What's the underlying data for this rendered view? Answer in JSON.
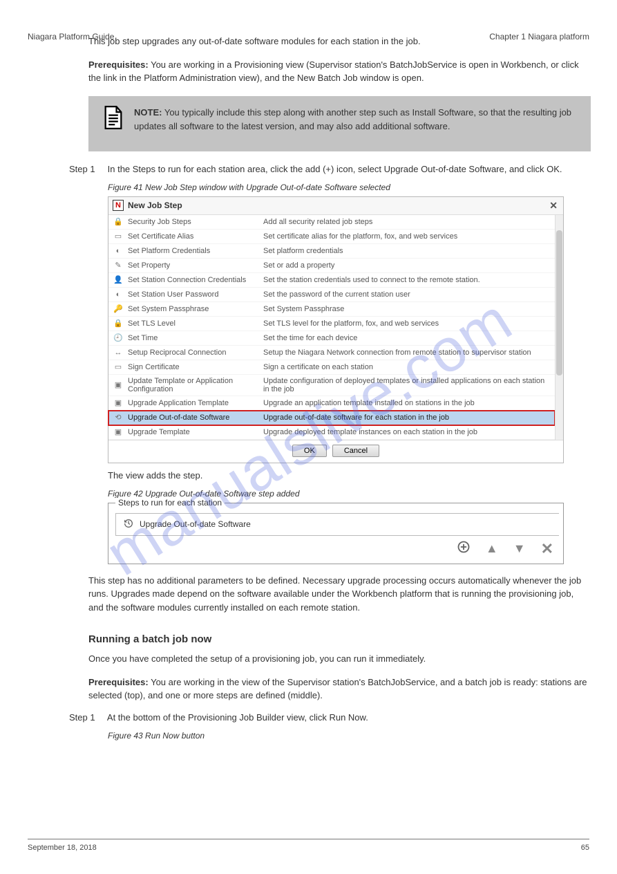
{
  "header": {
    "left": "Niagara Platform Guide",
    "right": "Chapter 1 Niagara platform"
  },
  "intro": "This job step upgrades any out-of-date software modules for each station in the job.",
  "prereq_label": "Prerequisites:",
  "prereq_text": "You are working in a Provisioning view (Supervisor station's BatchJobService is open in Workbench, or click the link in the Platform Administration view), and the New Batch Job window is open.",
  "note": {
    "label": "NOTE:",
    "text": "You typically include this step along with another step such as Install Software, so that the resulting job updates all software to the latest version, and may also add additional software."
  },
  "step1": "In the Steps to run for each station area, click the add (+) icon, select Upgrade Out-of-date Software, and click OK.",
  "step1_num": "Step 1",
  "figure1_caption": "Figure 41  New Job Step window with Upgrade Out-of-date Software selected",
  "dialog": {
    "title": "New Job Step",
    "rows": [
      {
        "icon": "🔒",
        "name": "Security Job Steps",
        "desc": "Add all security related job steps"
      },
      {
        "icon": "▭",
        "name": "Set Certificate Alias",
        "desc": "Set certificate alias for the platform, fox, and web services"
      },
      {
        "icon": "◐",
        "name": "Set Platform Credentials",
        "desc": "Set platform credentials"
      },
      {
        "icon": "✎",
        "name": "Set Property",
        "desc": "Set or add a property"
      },
      {
        "icon": "👤",
        "name": "Set Station Connection Credentials",
        "desc": "Set the station credentials used to connect to the remote station."
      },
      {
        "icon": "◐",
        "name": "Set Station User Password",
        "desc": "Set the password of the current station user"
      },
      {
        "icon": "🔑",
        "name": "Set System Passphrase",
        "desc": "Set System Passphrase"
      },
      {
        "icon": "🔒",
        "name": "Set TLS Level",
        "desc": "Set TLS level for the platform, fox, and web services"
      },
      {
        "icon": "🕘",
        "name": "Set Time",
        "desc": "Set the time for each device"
      },
      {
        "icon": "↔",
        "name": "Setup Reciprocal Connection",
        "desc": "Setup the Niagara Network connection from remote station to supervisor station"
      },
      {
        "icon": "▭",
        "name": "Sign Certificate",
        "desc": "Sign a certificate on each station"
      },
      {
        "icon": "▣",
        "name": "Update Template or Application Configuration",
        "desc": "Update configuration of deployed templates or installed applications on each station in the job"
      },
      {
        "icon": "▣",
        "name": "Upgrade Application Template",
        "desc": "Upgrade an application template installed on stations in the job"
      },
      {
        "icon": "⟲",
        "name": "Upgrade Out-of-date Software",
        "desc": "Upgrade out-of-date software for each station in the job",
        "selected": true
      },
      {
        "icon": "▣",
        "name": "Upgrade Template",
        "desc": "Upgrade deployed template instances on each station in the job"
      }
    ],
    "ok": "OK",
    "cancel": "Cancel"
  },
  "added_step_text": "The view adds the step.",
  "figure2_caption": "Figure 42  Upgrade Out-of-date Software step added",
  "steps_panel": {
    "legend": "Steps to run for each station",
    "item": "Upgrade Out-of-date Software"
  },
  "para_after": "This step has no additional parameters to be defined. Necessary upgrade processing occurs automatically whenever the job runs. Upgrades made depend on the software available under the Workbench platform that is running the provisioning job, and the software modules currently installed on each remote station.",
  "next_heading": "Running a batch job now",
  "next_intro": "Once you have completed the setup of a provisioning job, you can run it immediately.",
  "next_prereq_label": "Prerequisites:",
  "next_prereq_text": "You are working in the view of the Supervisor station's BatchJobService, and a batch job is ready: stations are selected (top), and one or more steps are defined (middle).",
  "next_step1": "At the bottom of the Provisioning Job Builder view, click Run Now.",
  "next_step1_figcap": "Figure 43  Run Now button",
  "watermark": "manualslive.com",
  "footer": {
    "left": "September 18, 2018",
    "right": "65"
  }
}
